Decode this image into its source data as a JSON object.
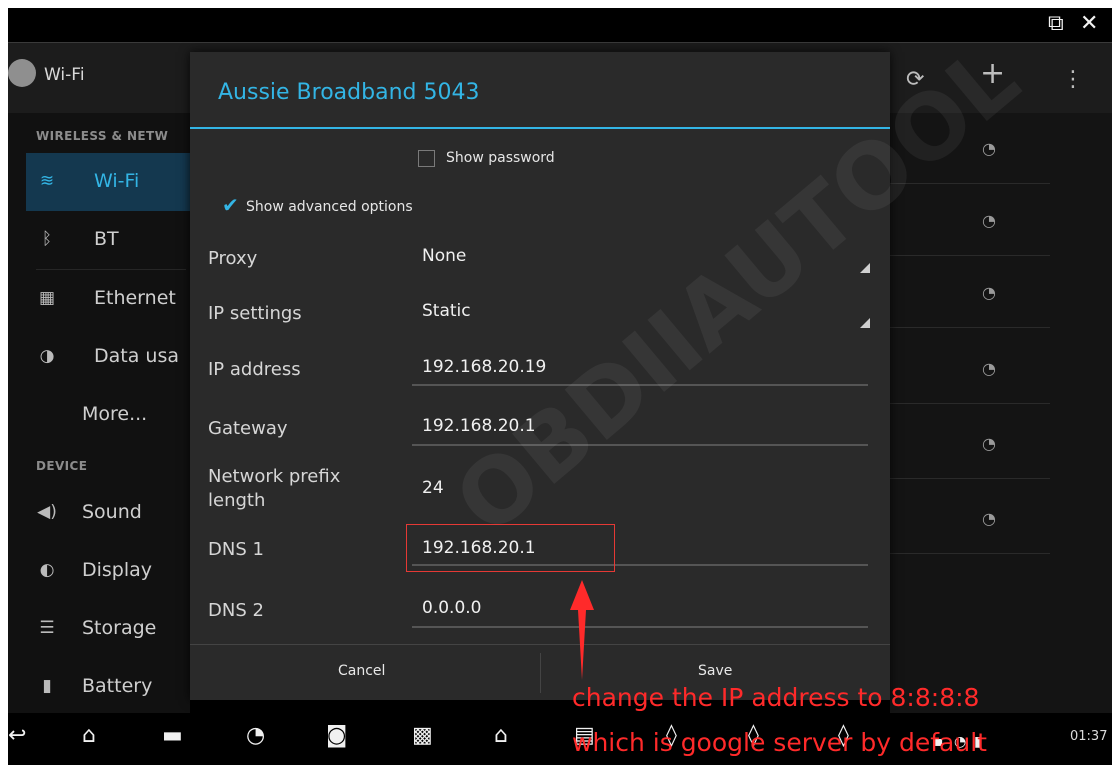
{
  "window": {
    "popout_icon": "popout-icon",
    "close_icon": "close-icon"
  },
  "actionbar": {
    "title": "Wi-Fi"
  },
  "sidebar": {
    "section_wireless": "WIRELESS & NETW",
    "section_device": "DEVICE",
    "items": [
      {
        "label": "Wi-Fi",
        "icon": "wifi-icon",
        "selected": true
      },
      {
        "label": "BT",
        "icon": "bluetooth-icon"
      },
      {
        "label": "Ethernet",
        "icon": "ethernet-icon"
      },
      {
        "label": "Data usa",
        "icon": "data-usage-icon"
      },
      {
        "label": "More...",
        "icon": ""
      },
      {
        "label": "Sound",
        "icon": "sound-icon"
      },
      {
        "label": "Display",
        "icon": "display-icon"
      },
      {
        "label": "Storage",
        "icon": "storage-icon"
      },
      {
        "label": "Battery",
        "icon": "battery-icon"
      }
    ]
  },
  "dialog": {
    "title": "Aussie Broadband 5043",
    "show_password": "Show password",
    "show_advanced": "Show advanced options",
    "fields": {
      "proxy": {
        "label": "Proxy",
        "value": "None"
      },
      "ip_settings": {
        "label": "IP settings",
        "value": "Static"
      },
      "ip_address": {
        "label": "IP address",
        "value": "192.168.20.19"
      },
      "gateway": {
        "label": "Gateway",
        "value": "192.168.20.1"
      },
      "prefix_line1": "Network prefix",
      "prefix_line2": "length",
      "prefix_value": "24",
      "dns1": {
        "label": "DNS 1",
        "value": "192.168.20.1"
      },
      "dns2": {
        "label": "DNS 2",
        "value": "0.0.0.0"
      }
    },
    "cancel": "Cancel",
    "save": "Save"
  },
  "status": {
    "time": "01:37"
  },
  "annotation": {
    "line1": "change the IP address to 8:8:8:8",
    "line2": "which is google server by default",
    "color": "#ff2a2a"
  },
  "colors": {
    "accent": "#33b5e5",
    "dialog_bg": "#2a2a2a"
  }
}
